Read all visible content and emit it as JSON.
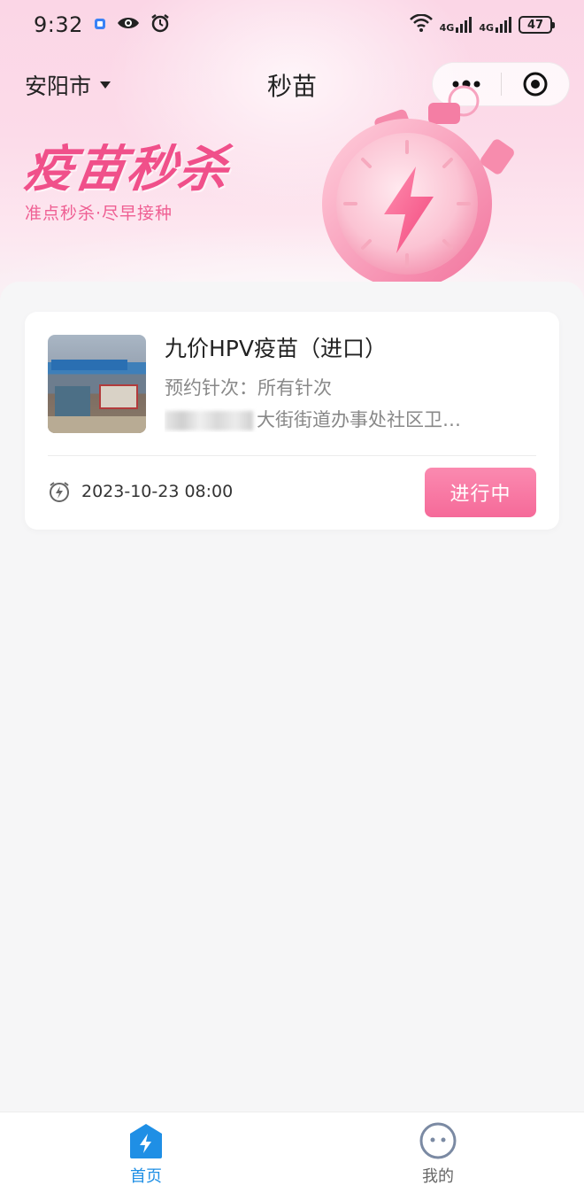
{
  "status_bar": {
    "time": "9:32",
    "signal1_label": "4G",
    "signal2_label": "4G",
    "battery": "47"
  },
  "nav": {
    "city": "安阳市",
    "title": "秒苗"
  },
  "banner": {
    "title": "疫苗秒杀",
    "subtitle": "准点秒杀·尽早接种"
  },
  "card": {
    "title": "九价HPV疫苗（进口）",
    "dose_label": "预约针次：",
    "dose_value": "所有针次",
    "address": "大街街道办事处社区卫…",
    "datetime": "2023-10-23 08:00",
    "status": "进行中"
  },
  "tabbar": {
    "items": [
      {
        "label": "首页",
        "icon": "home-lightning-icon",
        "active": true
      },
      {
        "label": "我的",
        "icon": "profile-face-icon",
        "active": false
      }
    ]
  },
  "colors": {
    "accent_pink": "#f56a99",
    "tab_active": "#1f8fe5",
    "banner_text": "#f0508a"
  }
}
